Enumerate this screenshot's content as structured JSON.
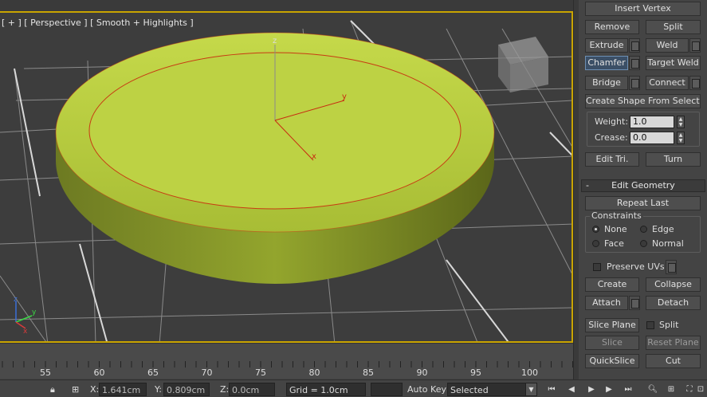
{
  "viewport": {
    "label": "[ + ] [ Perspective ] [ Smooth + Highlights ]",
    "gizmo_labels": {
      "z": "z",
      "y": "y",
      "x": "x"
    },
    "axis_tripod": {
      "z": "z",
      "y": "y",
      "x": "x"
    }
  },
  "ruler": {
    "ticks": [
      "55",
      "60",
      "65",
      "70",
      "75",
      "80",
      "85",
      "90",
      "95",
      "100"
    ]
  },
  "statusbar": {
    "x_label": "X:",
    "x_value": "1.641cm",
    "y_label": "Y:",
    "y_value": "0.809cm",
    "z_label": "Z:",
    "z_value": "0.0cm",
    "grid": "Grid = 1.0cm",
    "auto_key": "Auto Key",
    "selected": "Selected"
  },
  "panel": {
    "insert_vertex": "Insert Vertex",
    "remove": "Remove",
    "split": "Split",
    "extrude": "Extrude",
    "weld": "Weld",
    "chamfer": "Chamfer",
    "target_weld": "Target Weld",
    "bridge": "Bridge",
    "connect": "Connect",
    "create_shape": "Create Shape From Selection",
    "weight_label": "Weight:",
    "weight_value": "1.0",
    "crease_label": "Crease:",
    "crease_value": "0.0",
    "edit_tri": "Edit Tri.",
    "turn": "Turn",
    "rollout_minus": "-",
    "edit_geometry": "Edit Geometry",
    "repeat_last": "Repeat Last",
    "constraints": "Constraints",
    "c_none": "None",
    "c_edge": "Edge",
    "c_face": "Face",
    "c_normal": "Normal",
    "preserve_uvs": "Preserve UVs",
    "create": "Create",
    "collapse": "Collapse",
    "attach": "Attach",
    "detach": "Detach",
    "slice_plane": "Slice Plane",
    "split2": "Split",
    "slice": "Slice",
    "reset_plane": "Reset Plane",
    "quickslice": "QuickSlice",
    "cut": "Cut"
  },
  "colors": {
    "selection_border": "#c9a400",
    "object": "#b9cf3c",
    "active_button": "#3b4f66"
  }
}
